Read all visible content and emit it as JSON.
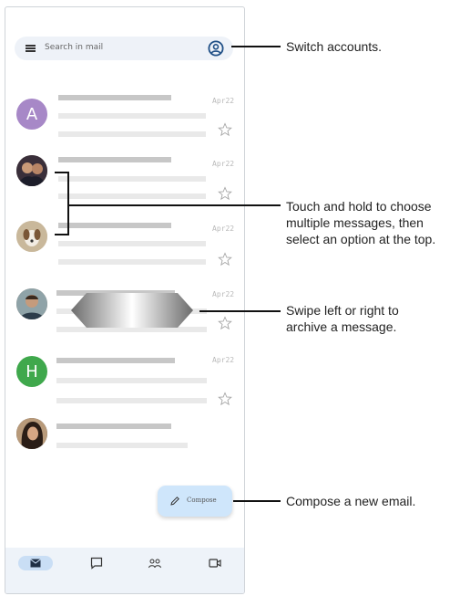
{
  "search": {
    "placeholder": "Search in mail"
  },
  "messages": [
    {
      "avatar_letter": "A",
      "avatar_color": "#a788c7",
      "date": "Apr22",
      "has_star": true
    },
    {
      "avatar_letter": "",
      "avatar_color": "#5a4638",
      "date": "Apr22",
      "has_star": true
    },
    {
      "avatar_letter": "",
      "avatar_color": "#d8cbb5",
      "date": "Apr22",
      "has_star": true
    },
    {
      "avatar_letter": "",
      "avatar_color": "#7c6a58",
      "date": "Apr22",
      "has_star": true
    },
    {
      "avatar_letter": "H",
      "avatar_color": "#3fa84c",
      "date": "Apr22",
      "has_star": true
    },
    {
      "avatar_letter": "",
      "avatar_color": "#4a3a30",
      "date": "",
      "has_star": false
    }
  ],
  "compose": {
    "label": "Compose"
  },
  "bottom_nav": [
    "mail-icon",
    "chat-icon",
    "spaces-icon",
    "meet-icon"
  ],
  "callouts": {
    "switch_accounts": "Switch accounts.",
    "multi_select": "Touch and hold to choose\nmultiple messages, then\nselect an option at the top.",
    "swipe": "Swipe left or right to\narchive a message.",
    "compose": "Compose a new email."
  },
  "colors": {
    "accent": "#2f5fa0",
    "compose_bg": "#cfe6fb",
    "nav_bg": "#eef3f9"
  }
}
